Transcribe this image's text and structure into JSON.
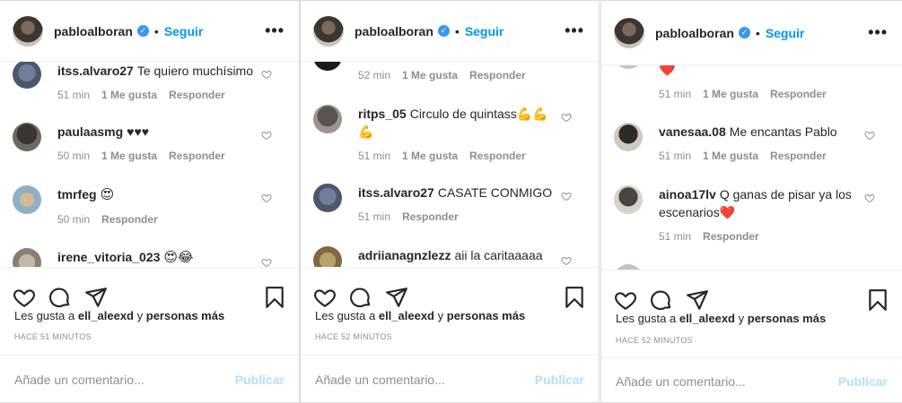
{
  "post": {
    "username": "pabloalboran",
    "dot": "•",
    "follow": "Seguir",
    "more": "•••",
    "likes_prefix": "Les gusta a",
    "likes_user": "ell_aleexd",
    "likes_middle": "y",
    "likes_suffix": "personas más",
    "add_comment_placeholder": "Añade un comentario...",
    "publish": "Publicar"
  },
  "panels": [
    {
      "time": "HACE 51 MINUTOS",
      "comments": [
        {
          "user": "itss.alvaro27",
          "text": "Te quiero muchísimo",
          "time": "51 min",
          "likes": "1 Me gusta",
          "reply": "Responder"
        },
        {
          "user": "paulaasmg",
          "text": "♥♥♥",
          "time": "50 min",
          "likes": "1 Me gusta",
          "reply": "Responder"
        },
        {
          "user": "tmrfeg",
          "text": "😍",
          "time": "50 min",
          "reply": "Responder"
        },
        {
          "user": "irene_vitoria_023",
          "text": "😍😂"
        }
      ]
    },
    {
      "time": "HACE 52 MINUTOS",
      "comments": [
        {
          "time": "52 min",
          "likes": "1 Me gusta",
          "reply": "Responder"
        },
        {
          "user": "ritps_05",
          "text": "Circulo de quintass💪💪💪",
          "time": "51 min",
          "likes": "1 Me gusta",
          "reply": "Responder"
        },
        {
          "user": "itss.alvaro27",
          "text": "CASATE CONMIGO",
          "time": "51 min",
          "reply": "Responder"
        },
        {
          "user": "adriianagnzlezz",
          "text": "aii la caritaaaaa"
        }
      ]
    },
    {
      "time": "HACE 52 MINUTOS",
      "comments": [
        {
          "text": "❤️",
          "time": "51 min",
          "likes": "1 Me gusta",
          "reply": "Responder"
        },
        {
          "user": "vanesaa.08",
          "text": "Me encantas Pablo",
          "time": "51 min",
          "likes": "1 Me gusta",
          "reply": "Responder"
        },
        {
          "user": "ainoa17lv",
          "text": "Q ganas de pisar ya los escenarios❤️",
          "time": "51 min",
          "reply": "Responder"
        }
      ]
    }
  ],
  "colors": {
    "link": "#0095f6",
    "muted": "#8e8e8e",
    "publish_disabled": "#b2dffc",
    "verified": "#3897f0"
  },
  "icons": [
    "verified-badge-icon",
    "heart-icon",
    "comment-icon",
    "share-icon",
    "bookmark-icon",
    "more-options-icon"
  ]
}
